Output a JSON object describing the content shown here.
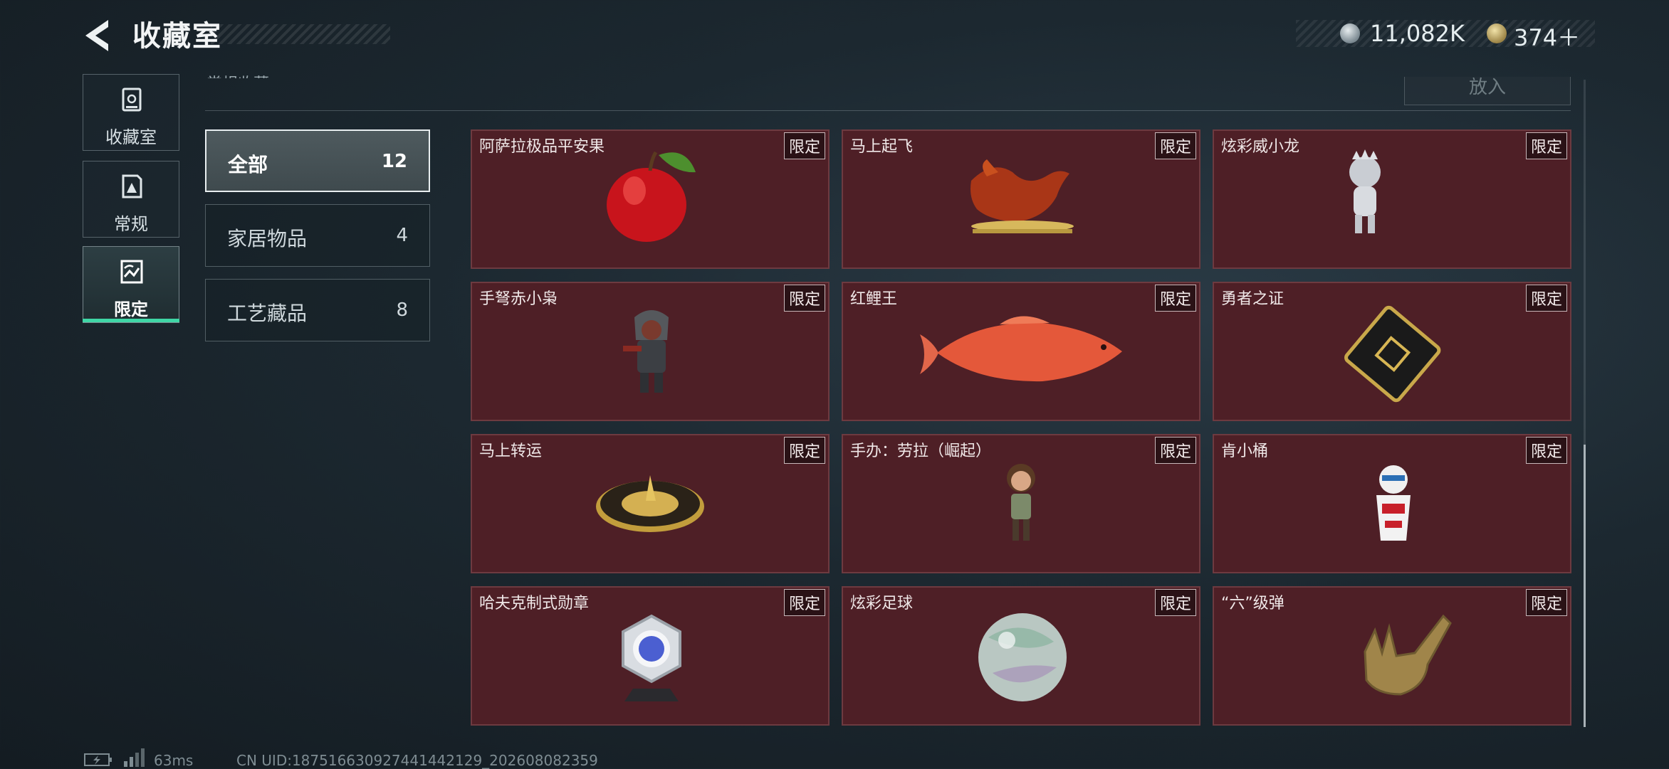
{
  "header": {
    "title": "收藏室",
    "currencies": [
      {
        "icon": "silver-coin-icon",
        "value": "11,082K"
      },
      {
        "icon": "gold-token-icon",
        "value": "374＋"
      }
    ]
  },
  "side_nav": [
    {
      "label": "收藏室",
      "icon": "collection-room-icon",
      "selected": false
    },
    {
      "label": "常规",
      "icon": "regular-card-icon",
      "selected": false
    },
    {
      "label": "限定",
      "icon": "limited-image-icon",
      "selected": true
    }
  ],
  "top_strip": {
    "section_label": "常规收藏",
    "put_in_label": "放入"
  },
  "categories": [
    {
      "label": "全部",
      "count": "12",
      "selected": true
    },
    {
      "label": "家居物品",
      "count": "4",
      "selected": false
    },
    {
      "label": "工艺藏品",
      "count": "8",
      "selected": false
    }
  ],
  "items": [
    {
      "name": "阿萨拉极品平安果",
      "badge": "限定",
      "icon": "red-apple-icon"
    },
    {
      "name": "马上起飞",
      "badge": "限定",
      "icon": "bronze-horse-icon"
    },
    {
      "name": "炫彩威小龙",
      "badge": "限定",
      "icon": "silver-dragon-figure-icon"
    },
    {
      "name": "手弩赤小枭",
      "badge": "限定",
      "icon": "hooded-crossbow-figure-icon"
    },
    {
      "name": "红鲤王",
      "badge": "限定",
      "icon": "red-carp-icon"
    },
    {
      "name": "勇者之证",
      "badge": "限定",
      "icon": "gold-emblem-card-icon"
    },
    {
      "name": "马上转运",
      "badge": "限定",
      "icon": "gold-compass-disc-icon"
    },
    {
      "name": "手办：劳拉（崛起）",
      "badge": "限定",
      "icon": "lara-figure-icon"
    },
    {
      "name": "肯小桶",
      "badge": "限定",
      "icon": "colonel-bucket-figure-icon"
    },
    {
      "name": "哈夫克制式勋章",
      "badge": "限定",
      "icon": "hex-medal-icon"
    },
    {
      "name": "炫彩足球",
      "badge": "限定",
      "icon": "iridescent-ball-icon"
    },
    {
      "name": "“六”级弹",
      "badge": "限定",
      "icon": "gold-hand-sign-icon"
    }
  ],
  "footer": {
    "ping": "63ms",
    "uid": "CN UID:1875166309274414421​29_202608082359"
  }
}
